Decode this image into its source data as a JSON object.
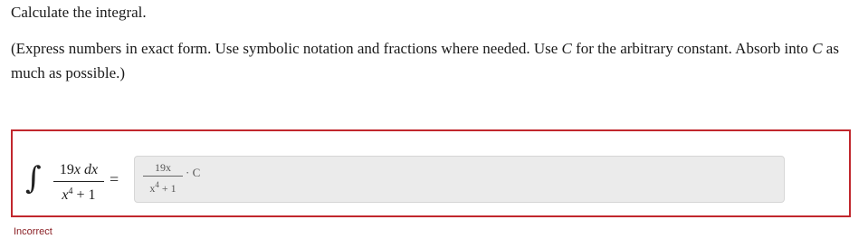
{
  "question": {
    "prompt": "Calculate the integral.",
    "instructions_part1": "(Express numbers in exact form. Use symbolic notation and fractions where needed. Use ",
    "instructions_var": "C",
    "instructions_part2": " for the arbitrary constant. Absorb into ",
    "instructions_var2": "C",
    "instructions_part3": " as much as possible.)"
  },
  "problem": {
    "integral_symbol": "∫",
    "numerator": "19x dx",
    "numerator_coef": "19",
    "numerator_var": "x",
    "numerator_diff": "dx",
    "denominator_base": "x",
    "denominator_exp": "4",
    "denominator_rest": " + 1",
    "equals": "="
  },
  "answer": {
    "numerator": "19x",
    "denominator_base": "x",
    "denominator_exp": "4",
    "denominator_rest": " + 1",
    "tail": "· C",
    "border_color": "#c1272d"
  },
  "status": {
    "text": "Incorrect",
    "color": "#8a1f24"
  }
}
